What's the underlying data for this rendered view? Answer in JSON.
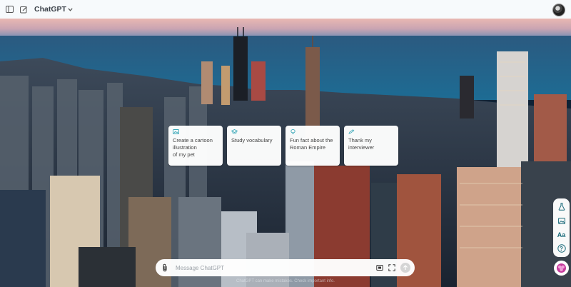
{
  "header": {
    "model_label": "ChatGPT"
  },
  "suggestions": [
    {
      "text": "Create a cartoon\nillustration\nof my pet",
      "icon": "image-icon",
      "icon_color": "#38a7b8"
    },
    {
      "text": "Study vocabulary",
      "icon": "graduation-cap-icon",
      "icon_color": "#38a7b8"
    },
    {
      "text": "Fun fact about the\nRoman Empire",
      "icon": "lightbulb-icon",
      "icon_color": "#38a7b8"
    },
    {
      "text": "Thank my\ninterviewer",
      "icon": "pen-icon",
      "icon_color": "#38a7b8"
    }
  ],
  "composer": {
    "placeholder": "Message ChatGPT"
  },
  "footer": {
    "disclaimer": "ChatGPT can make mistakes. Check important info."
  },
  "side_tools": [
    {
      "icon": "lab-flask-icon"
    },
    {
      "icon": "image-icon"
    },
    {
      "icon": "text-size-icon",
      "label": "Aa"
    },
    {
      "icon": "help-icon",
      "label": "?"
    }
  ],
  "colors": {
    "accent": "#38a7b8",
    "topbar_bg": "#f7fafc",
    "sky_top": "#e7b8b4",
    "lake": "#1f5c86"
  }
}
